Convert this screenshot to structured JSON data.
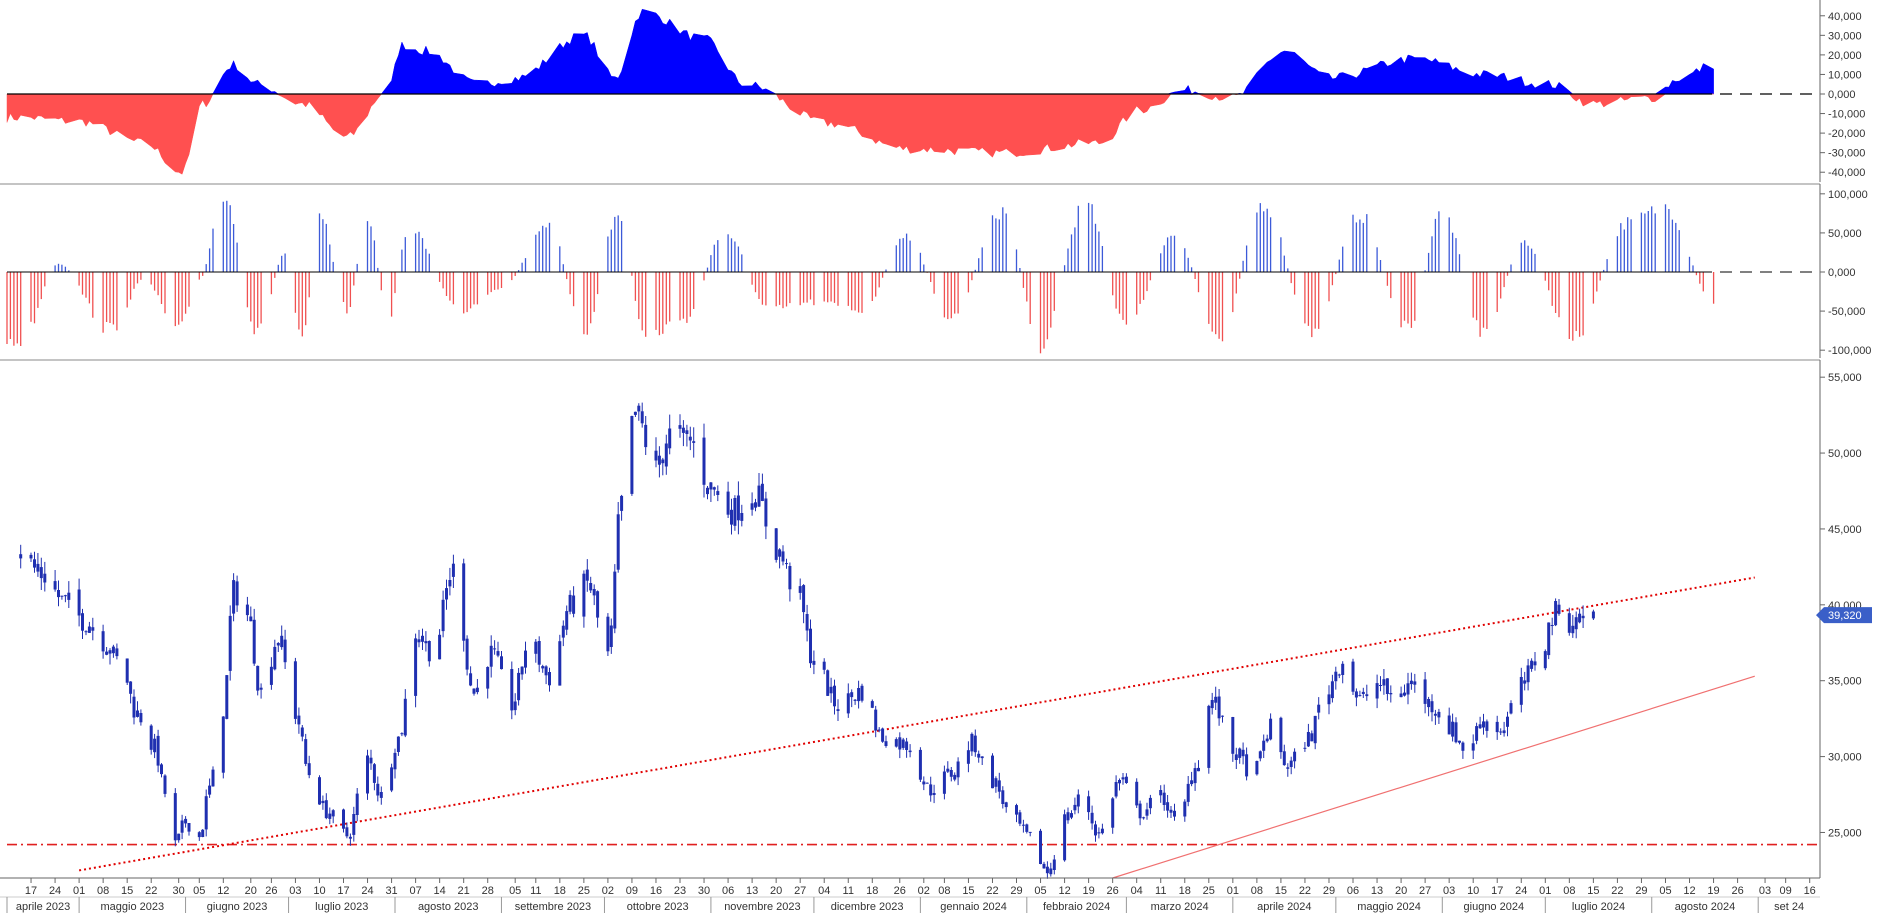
{
  "chart_data": [
    {
      "type": "area",
      "panel": "oscillator",
      "ylim": [
        -45000,
        45000
      ],
      "yticks": [
        "40,000",
        "30,000",
        "20,000",
        "10,000",
        "0,000",
        "-10,000",
        "-20,000",
        "-30,000",
        "-40,000"
      ],
      "ytick_values": [
        40000,
        30000,
        20000,
        10000,
        0,
        -10000,
        -20000,
        -30000,
        -40000
      ],
      "colors": {
        "positive": "#0000ff",
        "negative": "#ff5050"
      },
      "zero_line": "dashed",
      "x_dates": [
        "2023-04-14",
        "2023-05-01",
        "2023-05-20",
        "2023-05-31",
        "2023-06-06",
        "2023-06-15",
        "2023-06-22",
        "2023-07-05",
        "2023-07-18",
        "2023-07-30",
        "2023-08-03",
        "2023-08-10",
        "2023-08-25",
        "2023-09-05",
        "2023-09-25",
        "2023-10-04",
        "2023-10-12",
        "2023-10-30",
        "2023-11-11",
        "2023-12-05",
        "2023-12-28",
        "2024-01-25",
        "2024-02-22",
        "2024-03-05",
        "2024-03-18",
        "2024-04-01",
        "2024-04-16",
        "2024-04-29",
        "2024-05-24",
        "2024-06-13",
        "2024-07-02",
        "2024-07-15",
        "2024-08-01",
        "2024-08-09",
        "2024-08-19"
      ],
      "values": [
        -12000,
        -14000,
        -25000,
        -40000,
        -5000,
        15000,
        5000,
        -5000,
        -22000,
        2000,
        25000,
        22000,
        5000,
        8000,
        30000,
        8000,
        42000,
        28000,
        5000,
        -15000,
        -28000,
        -30000,
        -25000,
        -8000,
        2000,
        -2000,
        22000,
        8000,
        18000,
        10000,
        5000,
        -5000,
        -2000,
        8000,
        15000
      ]
    },
    {
      "type": "bar",
      "panel": "histogram",
      "ylim": [
        -110000,
        110000
      ],
      "yticks": [
        "100,000",
        "50,000",
        "0,000",
        "-50,000",
        "-100,000"
      ],
      "ytick_values": [
        100000,
        50000,
        0,
        -50000,
        -100000
      ],
      "colors": {
        "positive": "#3c5ad8",
        "negative": "#f05050"
      },
      "zero_line": "dashed",
      "x_dates": [
        "2023-04-14",
        "2023-04-25",
        "2023-05-10",
        "2023-05-20",
        "2023-05-30",
        "2023-06-05",
        "2023-06-12",
        "2023-06-22",
        "2023-06-30",
        "2023-07-05",
        "2023-07-10",
        "2023-07-18",
        "2023-07-24",
        "2023-07-30",
        "2023-08-05",
        "2023-08-20",
        "2023-09-01",
        "2023-09-15",
        "2023-09-25",
        "2023-10-05",
        "2023-10-13",
        "2023-10-25",
        "2023-11-05",
        "2023-11-18",
        "2023-12-01",
        "2023-12-15",
        "2023-12-28",
        "2024-01-10",
        "2024-01-25",
        "2024-02-05",
        "2024-02-18",
        "2024-03-01",
        "2024-03-15",
        "2024-03-28",
        "2024-04-10",
        "2024-04-24",
        "2024-05-08",
        "2024-05-22",
        "2024-06-01",
        "2024-06-13",
        "2024-06-25",
        "2024-07-09",
        "2024-07-25",
        "2024-08-05",
        "2024-08-19"
      ],
      "values": [
        -90000,
        10000,
        -75000,
        -10000,
        -78000,
        -10000,
        95000,
        -80000,
        25000,
        -95000,
        80000,
        -50000,
        70000,
        -60000,
        60000,
        -50000,
        -20000,
        60000,
        -80000,
        75000,
        -85000,
        -60000,
        55000,
        -50000,
        -40000,
        -50000,
        45000,
        -60000,
        80000,
        -95000,
        90000,
        -70000,
        50000,
        -85000,
        90000,
        -80000,
        75000,
        -75000,
        80000,
        -80000,
        40000,
        -90000,
        65000,
        85000,
        -40000
      ]
    },
    {
      "type": "candlestick",
      "panel": "price",
      "ylim": [
        22000,
        56000
      ],
      "yticks": [
        "55,000",
        "50,000",
        "45,000",
        "40,000",
        "35,000",
        "30,000",
        "25,000"
      ],
      "ytick_values": [
        55000,
        50000,
        45000,
        40000,
        35000,
        30000,
        25000
      ],
      "last_price_label": "39,320",
      "colors": {
        "candle": "#1f2fb0",
        "trendline": "#e00000",
        "support": "#e02020",
        "lower_channel": "#f07070",
        "last_price_bg": "#3a5fc8"
      },
      "horizontal_line": 24200,
      "trendline_dotted": {
        "from": [
          "2023-05-01",
          22500
        ],
        "to": [
          "2024-08-31",
          41800
        ]
      },
      "trendline_solid": {
        "from": [
          "2024-02-26",
          22000
        ],
        "to": [
          "2024-08-31",
          35300
        ]
      },
      "close_path": [
        [
          "2023-04-14",
          43500
        ],
        [
          "2023-04-20",
          42000
        ],
        [
          "2023-04-27",
          40200
        ],
        [
          "2023-05-03",
          38900
        ],
        [
          "2023-05-08",
          37600
        ],
        [
          "2023-05-13",
          36200
        ],
        [
          "2023-05-18",
          32800
        ],
        [
          "2023-05-23",
          30600
        ],
        [
          "2023-05-26",
          27600
        ],
        [
          "2023-05-29",
          24200
        ],
        [
          "2023-06-01",
          25700
        ],
        [
          "2023-06-05",
          24700
        ],
        [
          "2023-06-08",
          27900
        ],
        [
          "2023-06-12",
          33200
        ],
        [
          "2023-06-15",
          40900
        ],
        [
          "2023-06-19",
          39300
        ],
        [
          "2023-06-23",
          34300
        ],
        [
          "2023-06-28",
          37800
        ],
        [
          "2023-07-03",
          32800
        ],
        [
          "2023-07-07",
          28900
        ],
        [
          "2023-07-12",
          26400
        ],
        [
          "2023-07-18",
          24800
        ],
        [
          "2023-07-24",
          29800
        ],
        [
          "2023-07-28",
          27400
        ],
        [
          "2023-08-02",
          31200
        ],
        [
          "2023-08-07",
          38200
        ],
        [
          "2023-08-12",
          36900
        ],
        [
          "2023-08-18",
          42300
        ],
        [
          "2023-08-24",
          34200
        ],
        [
          "2023-08-29",
          36800
        ],
        [
          "2023-09-04",
          33400
        ],
        [
          "2023-09-09",
          37600
        ],
        [
          "2023-09-15",
          35200
        ],
        [
          "2023-09-21",
          39900
        ],
        [
          "2023-09-26",
          41400
        ],
        [
          "2023-10-02",
          36700
        ],
        [
          "2023-10-06",
          46700
        ],
        [
          "2023-10-10",
          52600
        ],
        [
          "2023-10-16",
          48900
        ],
        [
          "2023-10-20",
          51200
        ],
        [
          "2023-10-26",
          50800
        ],
        [
          "2023-11-01",
          47700
        ],
        [
          "2023-11-07",
          46200
        ],
        [
          "2023-11-14",
          47300
        ],
        [
          "2023-11-20",
          43600
        ],
        [
          "2023-11-26",
          40900
        ],
        [
          "2023-12-01",
          36300
        ],
        [
          "2023-12-08",
          33400
        ],
        [
          "2023-12-15",
          34300
        ],
        [
          "2023-12-21",
          31300
        ],
        [
          "2023-12-28",
          30800
        ],
        [
          "2024-01-04",
          27800
        ],
        [
          "2024-01-10",
          28900
        ],
        [
          "2024-01-16",
          30900
        ],
        [
          "2024-01-22",
          28400
        ],
        [
          "2024-01-28",
          25800
        ],
        [
          "2024-02-02",
          24600
        ],
        [
          "2024-02-07",
          22400
        ],
        [
          "2024-02-12",
          25900
        ],
        [
          "2024-02-17",
          27300
        ],
        [
          "2024-02-22",
          24900
        ],
        [
          "2024-02-28",
          28400
        ],
        [
          "2024-03-05",
          26300
        ],
        [
          "2024-03-11",
          27400
        ],
        [
          "2024-03-16",
          25500
        ],
        [
          "2024-03-21",
          29300
        ],
        [
          "2024-03-26",
          33700
        ],
        [
          "2024-04-01",
          30300
        ],
        [
          "2024-04-07",
          28900
        ],
        [
          "2024-04-12",
          31900
        ],
        [
          "2024-04-17",
          29400
        ],
        [
          "2024-04-23",
          31200
        ],
        [
          "2024-04-28",
          34300
        ],
        [
          "2024-05-03",
          36300
        ],
        [
          "2024-05-08",
          33700
        ],
        [
          "2024-05-13",
          34800
        ],
        [
          "2024-05-18",
          33900
        ],
        [
          "2024-05-23",
          34800
        ],
        [
          "2024-05-29",
          33400
        ],
        [
          "2024-06-03",
          31900
        ],
        [
          "2024-06-08",
          30400
        ],
        [
          "2024-06-13",
          32400
        ],
        [
          "2024-06-18",
          31800
        ],
        [
          "2024-06-24",
          34700
        ],
        [
          "2024-06-29",
          36500
        ],
        [
          "2024-07-04",
          39500
        ],
        [
          "2024-07-08",
          38900
        ],
        [
          "2024-07-12",
          39100
        ],
        [
          "2024-07-15",
          39320
        ]
      ]
    }
  ],
  "x_axis": {
    "day_ticks": [
      {
        "label": "17",
        "date": "2023-04-17"
      },
      {
        "label": "24",
        "date": "2023-04-24"
      },
      {
        "label": "01",
        "date": "2023-05-01"
      },
      {
        "label": "08",
        "date": "2023-05-08"
      },
      {
        "label": "15",
        "date": "2023-05-15"
      },
      {
        "label": "22",
        "date": "2023-05-22"
      },
      {
        "label": "30",
        "date": "2023-05-30"
      },
      {
        "label": "05",
        "date": "2023-06-05"
      },
      {
        "label": "12",
        "date": "2023-06-12"
      },
      {
        "label": "20",
        "date": "2023-06-20"
      },
      {
        "label": "26",
        "date": "2023-06-26"
      },
      {
        "label": "03",
        "date": "2023-07-03"
      },
      {
        "label": "10",
        "date": "2023-07-10"
      },
      {
        "label": "17",
        "date": "2023-07-17"
      },
      {
        "label": "24",
        "date": "2023-07-24"
      },
      {
        "label": "31",
        "date": "2023-07-31"
      },
      {
        "label": "07",
        "date": "2023-08-07"
      },
      {
        "label": "14",
        "date": "2023-08-14"
      },
      {
        "label": "21",
        "date": "2023-08-21"
      },
      {
        "label": "28",
        "date": "2023-08-28"
      },
      {
        "label": "05",
        "date": "2023-09-05"
      },
      {
        "label": "11",
        "date": "2023-09-11"
      },
      {
        "label": "18",
        "date": "2023-09-18"
      },
      {
        "label": "25",
        "date": "2023-09-25"
      },
      {
        "label": "02",
        "date": "2023-10-02"
      },
      {
        "label": "09",
        "date": "2023-10-09"
      },
      {
        "label": "16",
        "date": "2023-10-16"
      },
      {
        "label": "23",
        "date": "2023-10-23"
      },
      {
        "label": "30",
        "date": "2023-10-30"
      },
      {
        "label": "06",
        "date": "2023-11-06"
      },
      {
        "label": "13",
        "date": "2023-11-13"
      },
      {
        "label": "20",
        "date": "2023-11-20"
      },
      {
        "label": "27",
        "date": "2023-11-27"
      },
      {
        "label": "04",
        "date": "2023-12-04"
      },
      {
        "label": "11",
        "date": "2023-12-11"
      },
      {
        "label": "18",
        "date": "2023-12-18"
      },
      {
        "label": "26",
        "date": "2023-12-26"
      },
      {
        "label": "02",
        "date": "2024-01-02"
      },
      {
        "label": "08",
        "date": "2024-01-08"
      },
      {
        "label": "15",
        "date": "2024-01-15"
      },
      {
        "label": "22",
        "date": "2024-01-22"
      },
      {
        "label": "29",
        "date": "2024-01-29"
      },
      {
        "label": "05",
        "date": "2024-02-05"
      },
      {
        "label": "12",
        "date": "2024-02-12"
      },
      {
        "label": "19",
        "date": "2024-02-19"
      },
      {
        "label": "26",
        "date": "2024-02-26"
      },
      {
        "label": "04",
        "date": "2024-03-04"
      },
      {
        "label": "11",
        "date": "2024-03-11"
      },
      {
        "label": "18",
        "date": "2024-03-18"
      },
      {
        "label": "25",
        "date": "2024-03-25"
      },
      {
        "label": "01",
        "date": "2024-04-01"
      },
      {
        "label": "08",
        "date": "2024-04-08"
      },
      {
        "label": "15",
        "date": "2024-04-15"
      },
      {
        "label": "22",
        "date": "2024-04-22"
      },
      {
        "label": "29",
        "date": "2024-04-29"
      },
      {
        "label": "06",
        "date": "2024-05-06"
      },
      {
        "label": "13",
        "date": "2024-05-13"
      },
      {
        "label": "20",
        "date": "2024-05-20"
      },
      {
        "label": "27",
        "date": "2024-05-27"
      },
      {
        "label": "03",
        "date": "2024-06-03"
      },
      {
        "label": "10",
        "date": "2024-06-10"
      },
      {
        "label": "17",
        "date": "2024-06-17"
      },
      {
        "label": "24",
        "date": "2024-06-24"
      },
      {
        "label": "01",
        "date": "2024-07-01"
      },
      {
        "label": "08",
        "date": "2024-07-08"
      },
      {
        "label": "15",
        "date": "2024-07-15"
      },
      {
        "label": "22",
        "date": "2024-07-22"
      },
      {
        "label": "29",
        "date": "2024-07-29"
      },
      {
        "label": "05",
        "date": "2024-08-05"
      },
      {
        "label": "12",
        "date": "2024-08-12"
      },
      {
        "label": "19",
        "date": "2024-08-19"
      },
      {
        "label": "26",
        "date": "2024-08-26"
      },
      {
        "label": "03",
        "date": "2024-09-03"
      },
      {
        "label": "09",
        "date": "2024-09-09"
      },
      {
        "label": "16",
        "date": "2024-09-16"
      }
    ],
    "month_labels": [
      {
        "label": "aprile 2023",
        "start": "2023-04-10",
        "end": "2023-05-01"
      },
      {
        "label": "maggio 2023",
        "start": "2023-05-01",
        "end": "2023-06-01"
      },
      {
        "label": "giugno 2023",
        "start": "2023-06-01",
        "end": "2023-07-01"
      },
      {
        "label": "luglio 2023",
        "start": "2023-07-01",
        "end": "2023-08-01"
      },
      {
        "label": "agosto 2023",
        "start": "2023-08-01",
        "end": "2023-09-01"
      },
      {
        "label": "settembre 2023",
        "start": "2023-09-01",
        "end": "2023-10-01"
      },
      {
        "label": "ottobre 2023",
        "start": "2023-10-01",
        "end": "2023-11-01"
      },
      {
        "label": "novembre 2023",
        "start": "2023-11-01",
        "end": "2023-12-01"
      },
      {
        "label": "dicembre 2023",
        "start": "2023-12-01",
        "end": "2024-01-01"
      },
      {
        "label": "gennaio 2024",
        "start": "2024-01-01",
        "end": "2024-02-01"
      },
      {
        "label": "febbraio 2024",
        "start": "2024-02-01",
        "end": "2024-03-01"
      },
      {
        "label": "marzo 2024",
        "start": "2024-03-01",
        "end": "2024-04-01"
      },
      {
        "label": "aprile 2024",
        "start": "2024-04-01",
        "end": "2024-05-01"
      },
      {
        "label": "maggio 2024",
        "start": "2024-05-01",
        "end": "2024-06-01"
      },
      {
        "label": "giugno 2024",
        "start": "2024-06-01",
        "end": "2024-07-01"
      },
      {
        "label": "luglio 2024",
        "start": "2024-07-01",
        "end": "2024-08-01"
      },
      {
        "label": "agosto 2024",
        "start": "2024-08-01",
        "end": "2024-09-01"
      },
      {
        "label": "set 24",
        "start": "2024-09-01",
        "end": "2024-09-20"
      }
    ]
  }
}
